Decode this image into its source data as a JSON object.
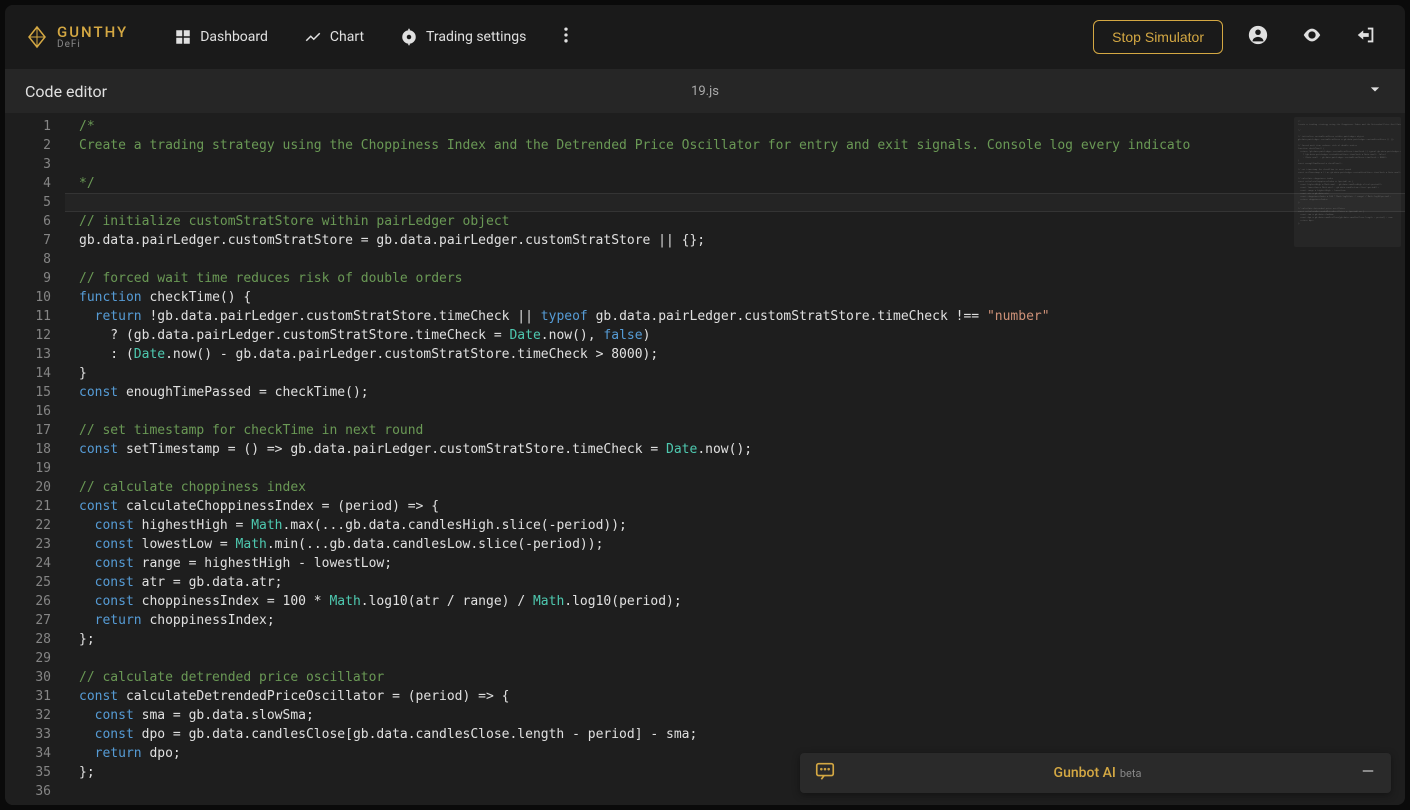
{
  "brand": {
    "name": "GUNTHY",
    "sub": "DeFi"
  },
  "nav": {
    "dashboard": "Dashboard",
    "chart": "Chart",
    "trading_settings": "Trading settings"
  },
  "actions": {
    "stop_simulator": "Stop Simulator"
  },
  "editor": {
    "panel_title": "Code editor",
    "filename": "19.js",
    "cursor_line": 5,
    "lines": [
      {
        "n": 1,
        "tokens": [
          [
            "c-comment",
            "/*"
          ]
        ]
      },
      {
        "n": 2,
        "tokens": [
          [
            "c-comment",
            "Create a trading strategy using the Choppiness Index and the Detrended Price Oscillator for entry and exit signals. Console log every indicato"
          ]
        ]
      },
      {
        "n": 3,
        "tokens": []
      },
      {
        "n": 4,
        "tokens": [
          [
            "c-comment",
            "*/"
          ]
        ]
      },
      {
        "n": 5,
        "tokens": []
      },
      {
        "n": 6,
        "tokens": [
          [
            "c-comment",
            "// initialize customStratStore within pairLedger object"
          ]
        ]
      },
      {
        "n": 7,
        "tokens": [
          [
            "",
            "gb.data.pairLedger.customStratStore = gb.data.pairLedger.customStratStore || {};"
          ]
        ]
      },
      {
        "n": 8,
        "tokens": []
      },
      {
        "n": 9,
        "tokens": [
          [
            "c-comment",
            "// forced wait time reduces risk of double orders"
          ]
        ]
      },
      {
        "n": 10,
        "tokens": [
          [
            "c-keyword",
            "function"
          ],
          [
            "",
            " checkTime() {"
          ]
        ]
      },
      {
        "n": 11,
        "tokens": [
          [
            "indent-guide",
            "  "
          ],
          [
            "c-keyword",
            "return"
          ],
          [
            "",
            " !gb.data.pairLedger.customStratStore.timeCheck || "
          ],
          [
            "c-keyword",
            "typeof"
          ],
          [
            "",
            " gb.data.pairLedger.customStratStore.timeCheck !== "
          ],
          [
            "c-string",
            "\"number\""
          ]
        ]
      },
      {
        "n": 12,
        "tokens": [
          [
            "indent-guide",
            "  "
          ],
          [
            "",
            "  ? (gb.data.pairLedger.customStratStore.timeCheck = "
          ],
          [
            "c-type",
            "Date"
          ],
          [
            "",
            ".now(), "
          ],
          [
            "c-const",
            "false"
          ],
          [
            "",
            ")"
          ]
        ]
      },
      {
        "n": 13,
        "tokens": [
          [
            "indent-guide",
            "  "
          ],
          [
            "",
            "  : ("
          ],
          [
            "c-type",
            "Date"
          ],
          [
            "",
            ".now() - gb.data.pairLedger.customStratStore.timeCheck > 8000);"
          ]
        ]
      },
      {
        "n": 14,
        "tokens": [
          [
            "",
            "}"
          ]
        ]
      },
      {
        "n": 15,
        "tokens": [
          [
            "c-keyword",
            "const"
          ],
          [
            "",
            " enoughTimePassed = checkTime();"
          ]
        ]
      },
      {
        "n": 16,
        "tokens": []
      },
      {
        "n": 17,
        "tokens": [
          [
            "c-comment",
            "// set timestamp for checkTime in next round"
          ]
        ]
      },
      {
        "n": 18,
        "tokens": [
          [
            "c-keyword",
            "const"
          ],
          [
            "",
            " setTimestamp = () => gb.data.pairLedger.customStratStore.timeCheck = "
          ],
          [
            "c-type",
            "Date"
          ],
          [
            "",
            ".now();"
          ]
        ]
      },
      {
        "n": 19,
        "tokens": []
      },
      {
        "n": 20,
        "tokens": [
          [
            "c-comment",
            "// calculate choppiness index"
          ]
        ]
      },
      {
        "n": 21,
        "tokens": [
          [
            "c-keyword",
            "const"
          ],
          [
            "",
            " calculateChoppinessIndex = (period) => {"
          ]
        ]
      },
      {
        "n": 22,
        "tokens": [
          [
            "indent-guide",
            "  "
          ],
          [
            "c-keyword",
            "const"
          ],
          [
            "",
            " highestHigh = "
          ],
          [
            "c-type",
            "Math"
          ],
          [
            "",
            ".max(...gb.data.candlesHigh.slice(-period));"
          ]
        ]
      },
      {
        "n": 23,
        "tokens": [
          [
            "indent-guide",
            "  "
          ],
          [
            "c-keyword",
            "const"
          ],
          [
            "",
            " lowestLow = "
          ],
          [
            "c-type",
            "Math"
          ],
          [
            "",
            ".min(...gb.data.candlesLow.slice(-period));"
          ]
        ]
      },
      {
        "n": 24,
        "tokens": [
          [
            "indent-guide",
            "  "
          ],
          [
            "c-keyword",
            "const"
          ],
          [
            "",
            " range = highestHigh - lowestLow;"
          ]
        ]
      },
      {
        "n": 25,
        "tokens": [
          [
            "indent-guide",
            "  "
          ],
          [
            "c-keyword",
            "const"
          ],
          [
            "",
            " atr = gb.data.atr;"
          ]
        ]
      },
      {
        "n": 26,
        "tokens": [
          [
            "indent-guide",
            "  "
          ],
          [
            "c-keyword",
            "const"
          ],
          [
            "",
            " choppinessIndex = 100 * "
          ],
          [
            "c-type",
            "Math"
          ],
          [
            "",
            ".log10(atr / range) / "
          ],
          [
            "c-type",
            "Math"
          ],
          [
            "",
            ".log10(period);"
          ]
        ]
      },
      {
        "n": 27,
        "tokens": [
          [
            "indent-guide",
            "  "
          ],
          [
            "c-keyword",
            "return"
          ],
          [
            "",
            " choppinessIndex;"
          ]
        ]
      },
      {
        "n": 28,
        "tokens": [
          [
            "",
            "};"
          ]
        ]
      },
      {
        "n": 29,
        "tokens": []
      },
      {
        "n": 30,
        "tokens": [
          [
            "c-comment",
            "// calculate detrended price oscillator"
          ]
        ]
      },
      {
        "n": 31,
        "tokens": [
          [
            "c-keyword",
            "const"
          ],
          [
            "",
            " calculateDetrendedPriceOscillator = (period) => {"
          ]
        ]
      },
      {
        "n": 32,
        "tokens": [
          [
            "indent-guide",
            "  "
          ],
          [
            "c-keyword",
            "const"
          ],
          [
            "",
            " sma = gb.data.slowSma;"
          ]
        ]
      },
      {
        "n": 33,
        "tokens": [
          [
            "indent-guide",
            "  "
          ],
          [
            "c-keyword",
            "const"
          ],
          [
            "",
            " dpo = gb.data.candlesClose[gb.data.candlesClose.length - period] - sma;"
          ]
        ]
      },
      {
        "n": 34,
        "tokens": [
          [
            "indent-guide",
            "  "
          ],
          [
            "c-keyword",
            "return"
          ],
          [
            "",
            " dpo;"
          ]
        ]
      },
      {
        "n": 35,
        "tokens": [
          [
            "",
            "};"
          ]
        ]
      },
      {
        "n": 36,
        "tokens": []
      }
    ]
  },
  "ai_bar": {
    "label": "Gunbot AI",
    "badge": "beta"
  }
}
